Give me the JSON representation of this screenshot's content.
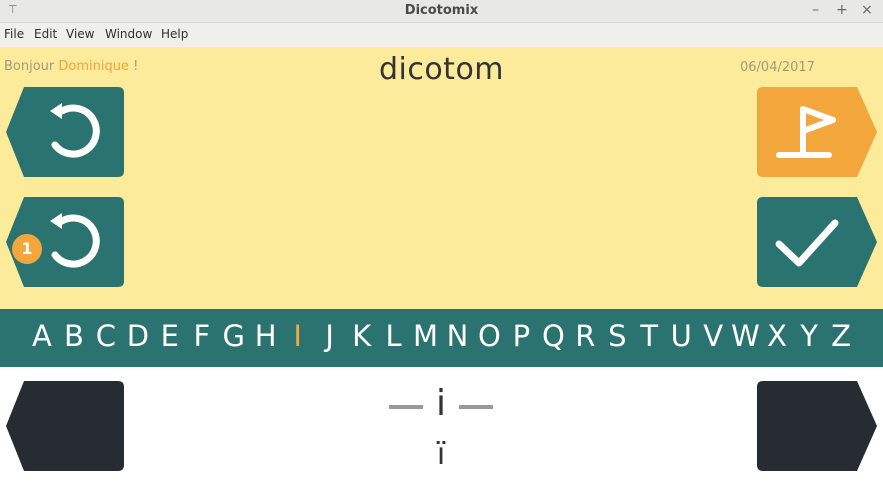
{
  "window": {
    "title": "Dicotomix"
  },
  "menu": {
    "items": [
      "File",
      "Edit",
      "View",
      "Window",
      "Help"
    ]
  },
  "header": {
    "greeting_prefix": "Bonjour",
    "user_name": "Dominique",
    "greeting_suffix": "!",
    "word": "dicotom",
    "date": "06/04/2017"
  },
  "buttons": {
    "undo_badge": "1",
    "colors": {
      "teal": "#2b7370",
      "orange": "#f2a63c",
      "dark": "#272c33",
      "white": "#ffffff"
    }
  },
  "alphabet": {
    "letters": [
      "A",
      "B",
      "C",
      "D",
      "E",
      "F",
      "G",
      "H",
      "I",
      "J",
      "K",
      "L",
      "M",
      "N",
      "O",
      "P",
      "Q",
      "R",
      "S",
      "T",
      "U",
      "V",
      "W",
      "X",
      "Y",
      "Z"
    ],
    "active": "I"
  },
  "selection": {
    "current": "i",
    "variant": "ï"
  }
}
